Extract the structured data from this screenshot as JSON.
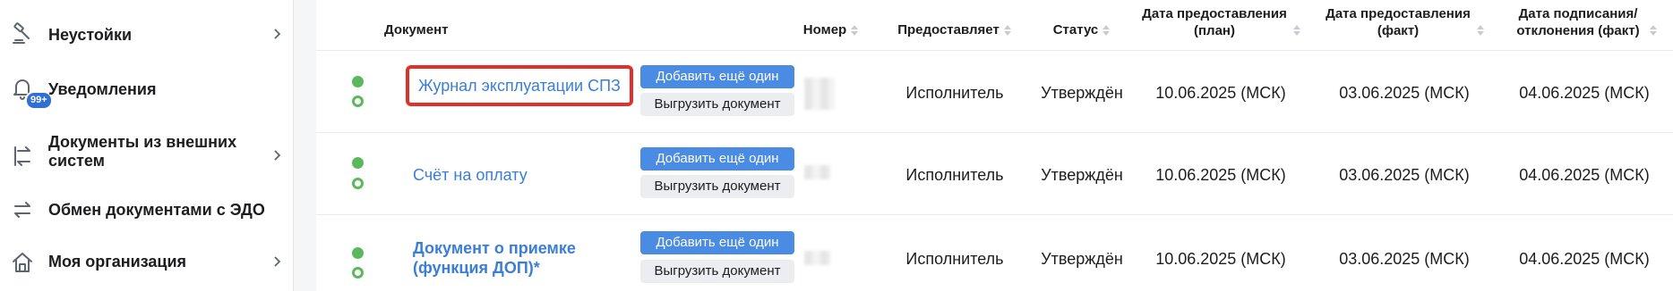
{
  "sidebar": {
    "items": [
      {
        "label": "Неустойки",
        "icon": "gavel-icon",
        "has_chevron": true
      },
      {
        "label": "Уведомления",
        "icon": "bell-icon",
        "badge": "99+",
        "has_chevron": false
      },
      {
        "label": "Документы из внешних систем",
        "icon": "swap-arrows-icon",
        "has_chevron": true
      },
      {
        "label": "Обмен документами с ЭДО",
        "icon": "exchange-icon",
        "has_chevron": false
      },
      {
        "label": "Моя организация",
        "icon": "home-icon",
        "has_chevron": true
      }
    ]
  },
  "table": {
    "headers": {
      "document": "Документ",
      "number": "Номер",
      "provider": "Предоставляет",
      "status": "Статус",
      "date_plan": "Дата предоставления (план)",
      "date_fact": "Дата предоставления (факт)",
      "date_sign": "Дата подписания/ отклонения (факт)"
    },
    "add_button_label": "Добавить ещё один",
    "export_button_label": "Выгрузить документ",
    "rows": [
      {
        "document": "Журнал эксплуатации СПЗ",
        "provider": "Исполнитель",
        "status": "Утверждён",
        "date_plan": "10.06.2025 (МСК)",
        "date_fact": "03.06.2025 (МСК)",
        "date_sign": "04.06.2025 (МСК)"
      },
      {
        "document": "Счёт на оплату",
        "provider": "Исполнитель",
        "status": "Утверждён",
        "date_plan": "10.06.2025 (МСК)",
        "date_fact": "03.06.2025 (МСК)",
        "date_sign": "04.06.2025 (МСК)"
      },
      {
        "document": "Документ о приемке (функция ДОП)*",
        "provider": "Исполнитель",
        "status": "Утверждён",
        "date_plan": "10.06.2025 (МСК)",
        "date_fact": "03.06.2025 (МСК)",
        "date_sign": "04.06.2025 (МСК)"
      }
    ]
  },
  "colors": {
    "link": "#3a7fd5",
    "primary_button": "#4a8be3",
    "status_dot": "#5cb85c",
    "highlight_border": "#e0302c",
    "badge": "#2f6fd6"
  }
}
